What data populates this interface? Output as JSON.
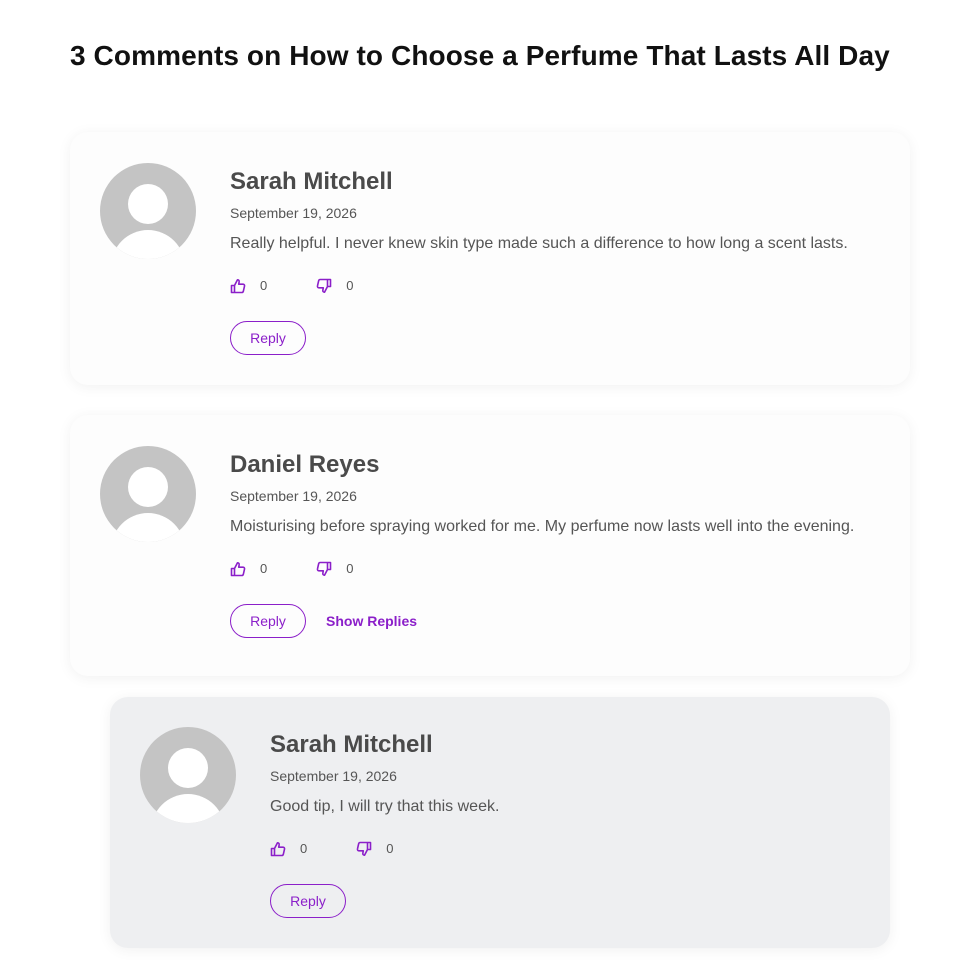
{
  "page": {
    "title": "3 Comments on How to Choose a Perfume That Lasts All Day"
  },
  "colors": {
    "accent": "#8b1fc9",
    "avatar": "#c4c4c4",
    "reply_bg": "#eeeff1"
  },
  "icons": {
    "like": "thumbs-up-icon",
    "dislike": "thumbs-down-icon",
    "avatar": "default-avatar-icon"
  },
  "comments": [
    {
      "author": "Sarah Mitchell",
      "date": "September 19, 2026",
      "text": "Really helpful. I never knew skin type made such a difference to how long a scent lasts.",
      "likes": "0",
      "dislikes": "0",
      "reply_label": "Reply"
    },
    {
      "author": "Daniel Reyes",
      "date": "September 19, 2026",
      "text": "Moisturising before spraying worked for me. My perfume now lasts well into the evening.",
      "likes": "0",
      "dislikes": "0",
      "reply_label": "Reply",
      "show_replies_label": "Show Replies",
      "replies": [
        {
          "author": "Sarah Mitchell",
          "date": "September 19, 2026",
          "text": "Good tip, I will try that this week.",
          "likes": "0",
          "dislikes": "0",
          "reply_label": "Reply"
        }
      ]
    }
  ]
}
